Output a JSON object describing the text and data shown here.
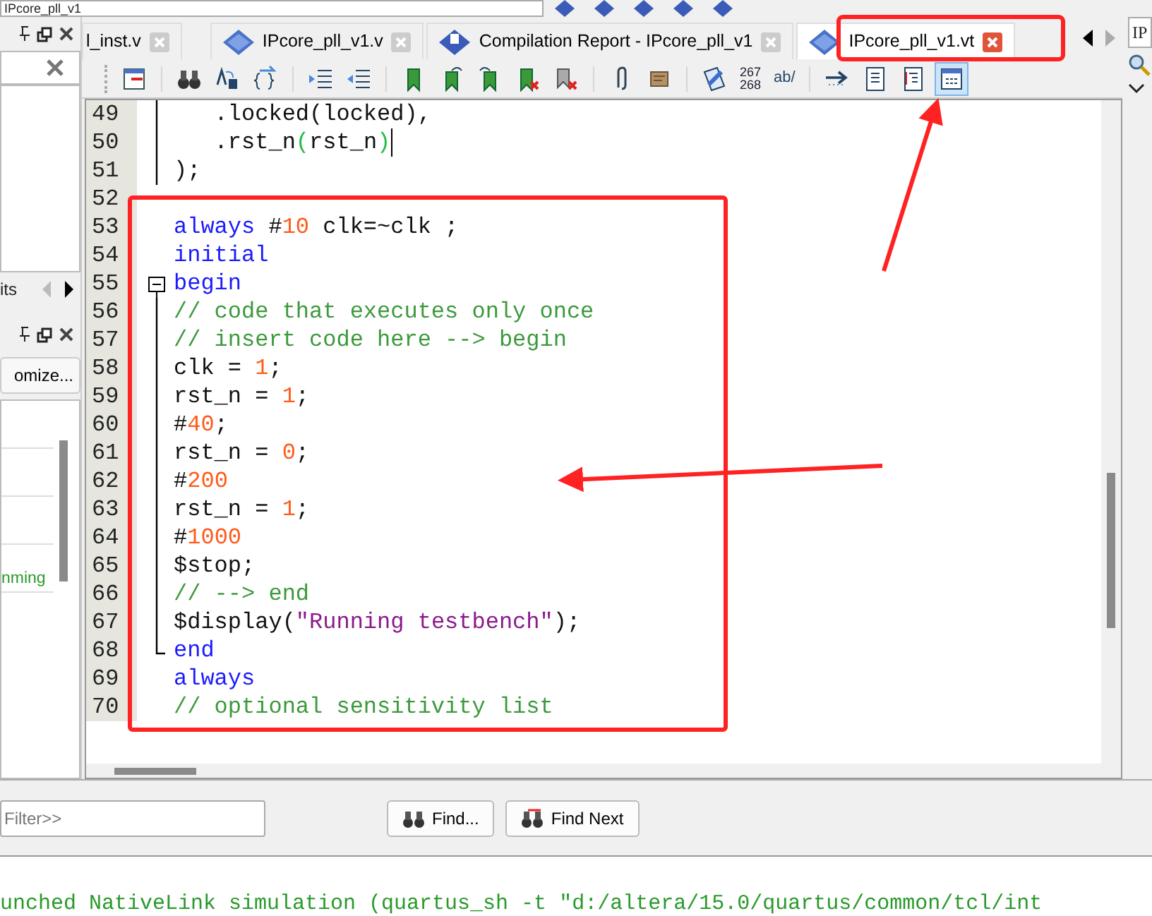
{
  "top_toolbar": {
    "field": "IPcore_pll_v1"
  },
  "left_panel": {
    "tab_label": "its",
    "button": "omize...",
    "messages": [
      {
        "text": "nming"
      }
    ]
  },
  "tabs": [
    {
      "label": "l_inst.v",
      "kind": "plain",
      "selected": false
    },
    {
      "label": "IPcore_pll_v1.v",
      "kind": "source",
      "selected": false
    },
    {
      "label": "Compilation Report - IPcore_pll_v1",
      "kind": "report",
      "selected": false
    },
    {
      "label": "IPcore_pll_v1.vt",
      "kind": "source",
      "selected": true
    }
  ],
  "editor_toolbar": [
    {
      "kind": "icon",
      "selected": false
    },
    {
      "kind": "separator"
    },
    {
      "kind": "icon",
      "selected": false
    },
    {
      "kind": "icon",
      "selected": false
    },
    {
      "kind": "icon",
      "selected": false
    },
    {
      "kind": "separator"
    },
    {
      "kind": "icon",
      "selected": false
    },
    {
      "kind": "icon",
      "selected": false
    },
    {
      "kind": "separator"
    },
    {
      "kind": "icon",
      "selected": false
    },
    {
      "kind": "icon",
      "selected": false
    },
    {
      "kind": "icon",
      "selected": false
    },
    {
      "kind": "icon",
      "selected": false
    },
    {
      "kind": "icon",
      "selected": false
    },
    {
      "kind": "separator"
    },
    {
      "kind": "icon",
      "selected": false
    },
    {
      "kind": "icon",
      "selected": false
    },
    {
      "kind": "separator"
    },
    {
      "kind": "icon",
      "selected": false
    },
    {
      "kind": "text",
      "lines": [
        "267",
        "268"
      ]
    },
    {
      "kind": "text",
      "lines": [
        "ab/"
      ]
    },
    {
      "kind": "separator"
    },
    {
      "kind": "icon",
      "selected": false
    },
    {
      "kind": "icon",
      "selected": false
    },
    {
      "kind": "icon",
      "selected": false
    },
    {
      "kind": "icon",
      "selected": true
    }
  ],
  "editor": {
    "lines": [
      {
        "number": "49",
        "fold_toggle": false,
        "fold_guide": true,
        "fold_end": false,
        "tokens": [
          {
            "kind": "plain",
            "text": "   .locked(locked),"
          }
        ]
      },
      {
        "number": "50",
        "fold_toggle": false,
        "fold_guide": true,
        "fold_end": false,
        "cursor": true,
        "tokens": [
          {
            "kind": "plain",
            "text": "   .rst_n"
          },
          {
            "kind": "match",
            "text": "("
          },
          {
            "kind": "plain",
            "text": "rst_n"
          },
          {
            "kind": "match",
            "text": ")"
          }
        ]
      },
      {
        "number": "51",
        "fold_toggle": false,
        "fold_guide": true,
        "fold_end": false,
        "tokens": [
          {
            "kind": "plain",
            "text": ");"
          }
        ]
      },
      {
        "number": "52",
        "fold_toggle": false,
        "fold_guide": false,
        "fold_end": false
      },
      {
        "number": "53",
        "fold_toggle": false,
        "fold_guide": false,
        "fold_end": false,
        "tokens": [
          {
            "kind": "keyword",
            "text": "always"
          },
          {
            "kind": "plain",
            "text": " #"
          },
          {
            "kind": "number",
            "text": "10"
          },
          {
            "kind": "plain",
            "text": " clk=~clk ;"
          }
        ]
      },
      {
        "number": "54",
        "fold_toggle": false,
        "fold_guide": false,
        "fold_end": false,
        "tokens": [
          {
            "kind": "keyword",
            "text": "initial"
          }
        ]
      },
      {
        "number": "55",
        "fold_toggle": true,
        "fold_guide": false,
        "fold_end": false,
        "tokens": [
          {
            "kind": "keyword",
            "text": "begin"
          }
        ]
      },
      {
        "number": "56",
        "fold_toggle": false,
        "fold_guide": true,
        "fold_end": false,
        "tokens": [
          {
            "kind": "comment",
            "text": "// code that executes only once"
          }
        ]
      },
      {
        "number": "57",
        "fold_toggle": false,
        "fold_guide": true,
        "fold_end": false,
        "tokens": [
          {
            "kind": "comment",
            "text": "// insert code here --> begin"
          }
        ]
      },
      {
        "number": "58",
        "fold_toggle": false,
        "fold_guide": true,
        "fold_end": false,
        "tokens": [
          {
            "kind": "plain",
            "text": "clk = "
          },
          {
            "kind": "number",
            "text": "1"
          },
          {
            "kind": "plain",
            "text": ";"
          }
        ]
      },
      {
        "number": "59",
        "fold_toggle": false,
        "fold_guide": true,
        "fold_end": false,
        "tokens": [
          {
            "kind": "plain",
            "text": "rst_n = "
          },
          {
            "kind": "number",
            "text": "1"
          },
          {
            "kind": "plain",
            "text": ";"
          }
        ]
      },
      {
        "number": "60",
        "fold_toggle": false,
        "fold_guide": true,
        "fold_end": false,
        "tokens": [
          {
            "kind": "plain",
            "text": "#"
          },
          {
            "kind": "number",
            "text": "40"
          },
          {
            "kind": "plain",
            "text": ";"
          }
        ]
      },
      {
        "number": "61",
        "fold_toggle": false,
        "fold_guide": true,
        "fold_end": false,
        "tokens": [
          {
            "kind": "plain",
            "text": "rst_n = "
          },
          {
            "kind": "number",
            "text": "0"
          },
          {
            "kind": "plain",
            "text": ";"
          }
        ]
      },
      {
        "number": "62",
        "fold_toggle": false,
        "fold_guide": true,
        "fold_end": false,
        "tokens": [
          {
            "kind": "plain",
            "text": "#"
          },
          {
            "kind": "number",
            "text": "200"
          }
        ]
      },
      {
        "number": "63",
        "fold_toggle": false,
        "fold_guide": true,
        "fold_end": false,
        "tokens": [
          {
            "kind": "plain",
            "text": "rst_n = "
          },
          {
            "kind": "number",
            "text": "1"
          },
          {
            "kind": "plain",
            "text": ";"
          }
        ]
      },
      {
        "number": "64",
        "fold_toggle": false,
        "fold_guide": true,
        "fold_end": false,
        "tokens": [
          {
            "kind": "plain",
            "text": "#"
          },
          {
            "kind": "number",
            "text": "1000"
          }
        ]
      },
      {
        "number": "65",
        "fold_toggle": false,
        "fold_guide": true,
        "fold_end": false,
        "tokens": [
          {
            "kind": "plain",
            "text": "$stop;"
          }
        ]
      },
      {
        "number": "66",
        "fold_toggle": false,
        "fold_guide": true,
        "fold_end": false,
        "tokens": [
          {
            "kind": "comment",
            "text": "// --> end"
          }
        ]
      },
      {
        "number": "67",
        "fold_toggle": false,
        "fold_guide": true,
        "fold_end": false,
        "tokens": [
          {
            "kind": "plain",
            "text": "$display("
          },
          {
            "kind": "string",
            "text": "\"Running testbench\""
          },
          {
            "kind": "plain",
            "text": ");"
          }
        ]
      },
      {
        "number": "68",
        "fold_toggle": false,
        "fold_guide": false,
        "fold_end": true,
        "tokens": [
          {
            "kind": "keyword",
            "text": "end"
          }
        ]
      },
      {
        "number": "69",
        "fold_toggle": false,
        "fold_guide": false,
        "fold_end": false,
        "tokens": [
          {
            "kind": "keyword",
            "text": "always"
          }
        ]
      },
      {
        "number": "70",
        "fold_toggle": false,
        "fold_guide": false,
        "fold_end": false,
        "tokens": [
          {
            "kind": "comment",
            "text": "// optional sensitivity list"
          }
        ]
      }
    ]
  },
  "right_panel": {
    "tab_label": "IP"
  },
  "find_bar": {
    "placeholder": "Filter>>",
    "buttons": [
      "Find...",
      "Find Next"
    ]
  },
  "messages": [
    {
      "text": "unched NativeLink simulation (quartus_sh -t \"d:/altera/15.0/quartus/common/tcl/int"
    }
  ]
}
